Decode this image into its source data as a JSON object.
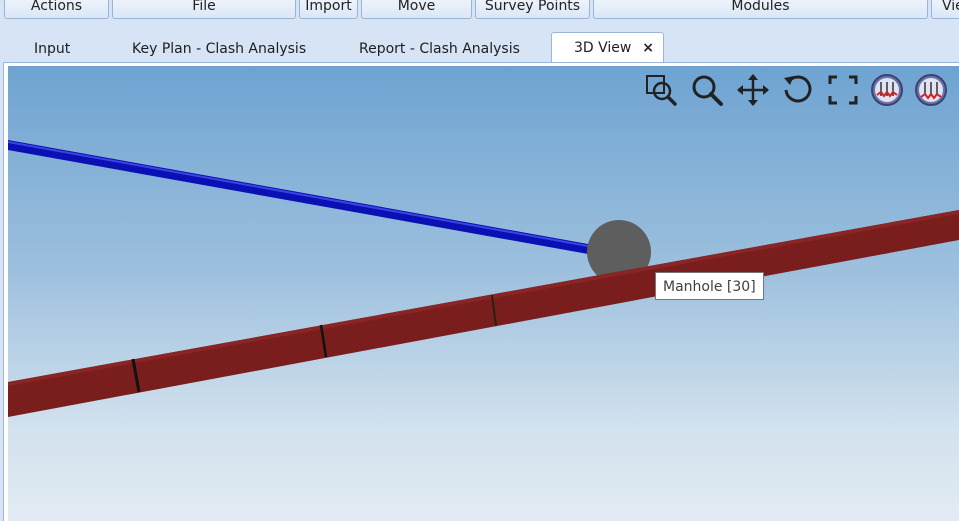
{
  "ribbon": {
    "actions": "Actions",
    "file": "File",
    "import": "Import",
    "move": "Move",
    "survey_points": "Survey Points",
    "modules": "Modules",
    "view": "Vie"
  },
  "tabs": {
    "input": "Input",
    "key_plan": "Key Plan - Clash Analysis",
    "report": "Report - Clash Analysis",
    "view3d": "3D View",
    "close": "×"
  },
  "toolbar": {
    "icons": [
      "zoom-window-icon",
      "zoom-icon",
      "pan-icon",
      "rotate-icon",
      "fit-all-icon",
      "profile-up-icon",
      "profile-down-icon"
    ]
  },
  "scene": {
    "tooltip": "Manhole [30]",
    "colors": {
      "blue_pipe": "#0a10b4",
      "red_pipe": "#7a1d1d",
      "manhole": "#5e5e5e"
    }
  }
}
